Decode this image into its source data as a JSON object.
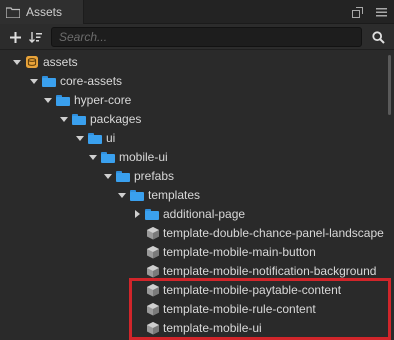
{
  "panel": {
    "title": "Assets",
    "icons": {
      "tab": "assets-folder-icon",
      "popout": "popout-icon",
      "menu": "hamburger-menu-icon",
      "add": "add-icon",
      "sort": "sort-icon",
      "search": "search-icon"
    }
  },
  "search": {
    "placeholder": "Search..."
  },
  "tree": {
    "items": [
      {
        "label": "assets",
        "kind": "database",
        "level": 0,
        "expanded": true
      },
      {
        "label": "core-assets",
        "kind": "folder",
        "level": 1,
        "expanded": true
      },
      {
        "label": "hyper-core",
        "kind": "folder",
        "level": 2,
        "expanded": true
      },
      {
        "label": "packages",
        "kind": "folder",
        "level": 3,
        "expanded": true
      },
      {
        "label": "ui",
        "kind": "folder",
        "level": 4,
        "expanded": true
      },
      {
        "label": "mobile-ui",
        "kind": "folder",
        "level": 5,
        "expanded": true
      },
      {
        "label": "prefabs",
        "kind": "folder",
        "level": 6,
        "expanded": true
      },
      {
        "label": "templates",
        "kind": "folder",
        "level": 7,
        "expanded": true
      },
      {
        "label": "additional-page",
        "kind": "folder",
        "level": 8,
        "expanded": false
      },
      {
        "label": "template-double-chance-panel-landscape",
        "kind": "prefab",
        "level": 8
      },
      {
        "label": "template-mobile-main-button",
        "kind": "prefab",
        "level": 8
      },
      {
        "label": "template-mobile-notification-background",
        "kind": "prefab",
        "level": 8
      },
      {
        "label": "template-mobile-paytable-content",
        "kind": "prefab",
        "level": 8
      },
      {
        "label": "template-mobile-rule-content",
        "kind": "prefab",
        "level": 8
      },
      {
        "label": "template-mobile-ui",
        "kind": "prefab",
        "level": 8
      }
    ]
  },
  "colors": {
    "panel_bg": "#2a2a2a",
    "folder": "#3aa0ee",
    "database": "#e8a33a",
    "highlight": "#d1252a"
  }
}
